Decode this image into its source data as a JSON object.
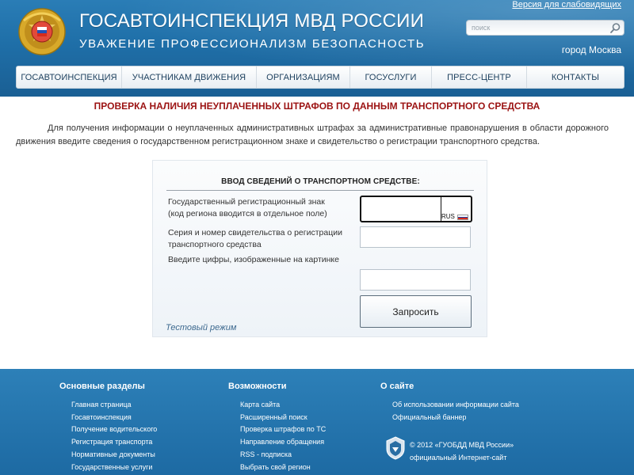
{
  "header": {
    "title": "ГОСАВТОИНСПЕКЦИЯ МВД РОССИИ",
    "slogan": "УВАЖЕНИЕ  ПРОФЕССИОНАЛИЗМ  БЕЗОПАСНОСТЬ",
    "accessible_link": "Версия для слабовидящих",
    "search_placeholder": "поиск",
    "city": "город Москва"
  },
  "nav": {
    "items": [
      {
        "label": "ГОСАВТОИНСПЕКЦИЯ"
      },
      {
        "label": "УЧАСТНИКАМ ДВИЖЕНИЯ"
      },
      {
        "label": "ОРГАНИЗАЦИЯМ"
      },
      {
        "label": "ГОСУСЛУГИ"
      },
      {
        "label": "ПРЕСС-ЦЕНТР"
      },
      {
        "label": "КОНТАКТЫ"
      }
    ]
  },
  "main": {
    "title": "ПРОВЕРКА НАЛИЧИЯ НЕУПЛАЧЕННЫХ ШТРАФОВ ПО ДАННЫМ ТРАНСПОРТНОГО СРЕДСТВА",
    "intro": "Для получения информации о неуплаченных административных штрафах за административные правонарушения в области дорожного движения введите сведения о государственном регистрационном знаке и свидетельство о регистрации транспортного средства."
  },
  "form": {
    "title": "ВВОД СВЕДЕНИЙ О ТРАНСПОРТНОМ СРЕДСТВЕ:",
    "plate_label_line1": "Государственный регистрационный знак",
    "plate_label_line2": "(код региона вводится в отдельное поле)",
    "plate_number_value": "",
    "plate_region_value": "",
    "plate_country": "RUS",
    "cert_label_line1": "Серия и номер свидетельства о регистрации",
    "cert_label_line2": "транспортного средства",
    "cert_value": "",
    "captcha_label": "Введите цифры, изображенные на картинке",
    "captcha_value": "",
    "submit_label": "Запросить",
    "test_mode": "Тестовый режим"
  },
  "footer": {
    "col1": {
      "heading": "Основные разделы",
      "links": [
        "Главная страница",
        "Госавтоинспекция",
        "Получение водительского",
        "Регистрация транспорта",
        "Нормативные документы",
        "Государственные услуги"
      ]
    },
    "col2": {
      "heading": "Возможности",
      "links": [
        "Карта сайта",
        "Расширенный поиск",
        "Проверка штрафов по ТС",
        "Направление обращения",
        "RSS - подписка",
        "Выбрать свой регион"
      ]
    },
    "col3": {
      "heading": "О сайте",
      "links": [
        "Об использовании информации сайта",
        "Официальный баннер"
      ]
    },
    "copyright_line1": "© 2012 «ГУОБДД МВД России»",
    "copyright_line2": "официальный Интернет-сайт"
  },
  "colors": {
    "header_blue": "#1f6fa8",
    "title_red": "#9b1212",
    "flag_white": "#ffffff",
    "flag_blue": "#1a3fa5",
    "flag_red": "#d52b1e"
  },
  "icons": [
    "gibdd-emblem-icon",
    "search-icon",
    "russian-flag-icon",
    "footer-emblem-icon"
  ]
}
